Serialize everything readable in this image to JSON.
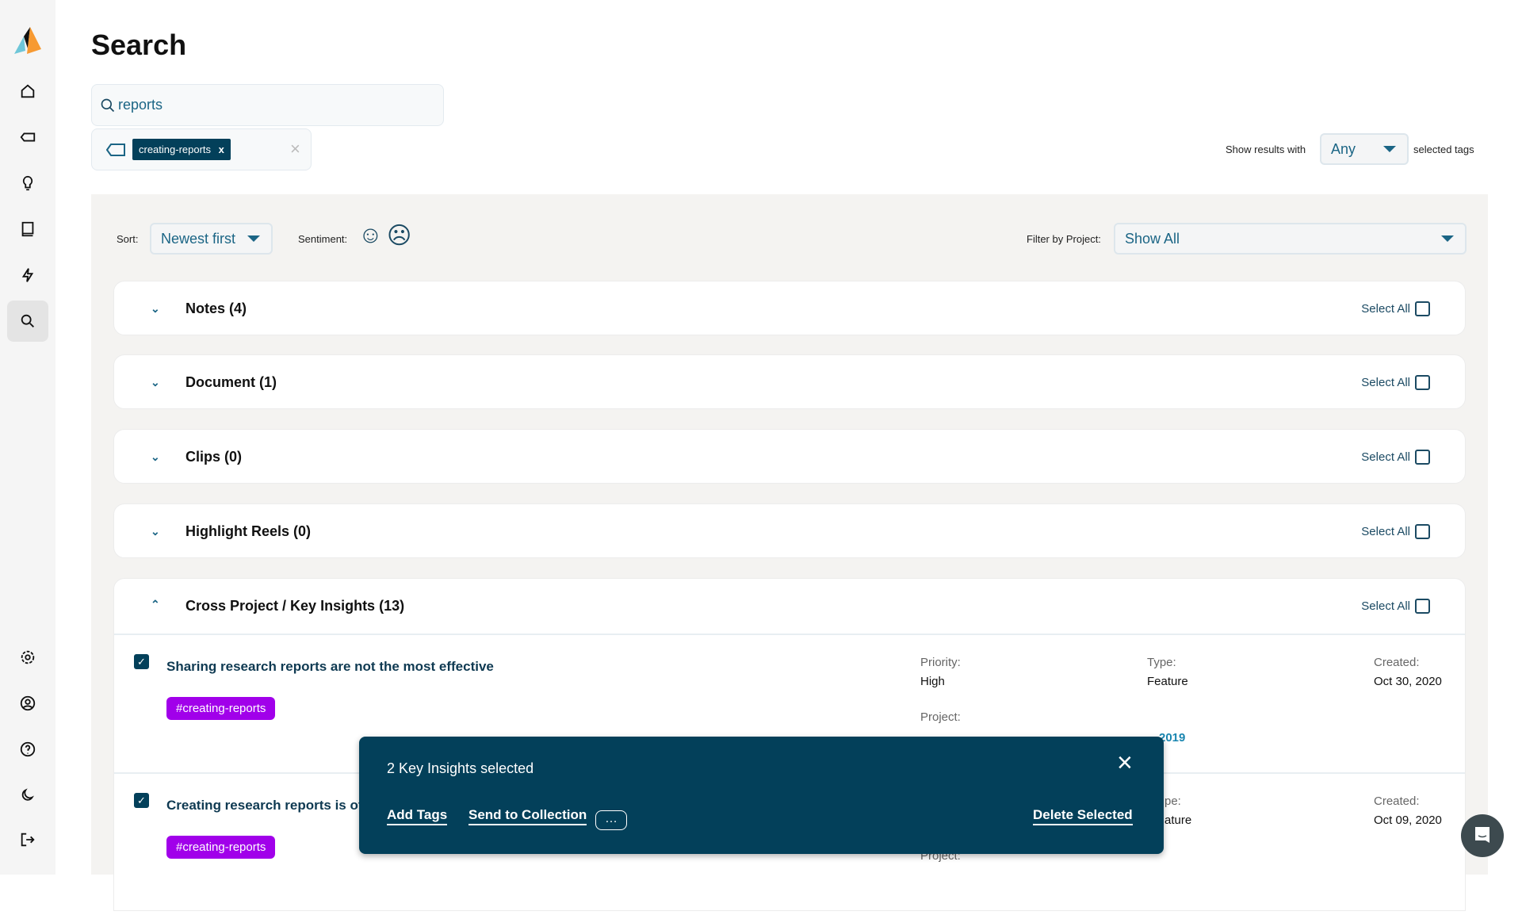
{
  "page": {
    "title": "Search"
  },
  "sidebar": {
    "items": [
      "home",
      "tags",
      "insights",
      "library",
      "activity",
      "search",
      "settings",
      "profile",
      "help",
      "dark-mode",
      "logout"
    ],
    "active": "search"
  },
  "search": {
    "value": "reports",
    "tags": [
      {
        "label": "creating-reports",
        "remove": "x"
      }
    ],
    "clear": "×"
  },
  "tag_match": {
    "prefix": "Show results with",
    "value": "Any",
    "suffix": "selected tags"
  },
  "toolbar": {
    "sort_label": "Sort:",
    "sort_value": "Newest first",
    "sentiment_label": "Sentiment:",
    "sentiment_positive": "☺",
    "sentiment_negative": "☹",
    "filter_label": "Filter by Project:",
    "filter_value": "Show All"
  },
  "sections": [
    {
      "title": "Notes (4)",
      "select_all": "Select All",
      "expanded": false
    },
    {
      "title": "Document (1)",
      "select_all": "Select All",
      "expanded": false
    },
    {
      "title": "Clips (0)",
      "select_all": "Select All",
      "expanded": false
    },
    {
      "title": "Highlight Reels (0)",
      "select_all": "Select All",
      "expanded": false
    },
    {
      "title": "Cross Project / Key Insights (13)",
      "select_all": "Select All",
      "expanded": true
    }
  ],
  "insights": [
    {
      "title": "Sharing research reports are not the most effective",
      "tag": "#creating-reports",
      "checked": true,
      "priority_label": "Priority:",
      "priority": "High",
      "type_label": "Type:",
      "type": "Feature",
      "created_label": "Created:",
      "created": "Oct 30, 2020",
      "project_label": "Project:",
      "project": "2019"
    },
    {
      "title": "Creating research reports is of",
      "tag": "#creating-reports",
      "checked": true,
      "type_label": "pe:",
      "type": "ature",
      "created_label": "Created:",
      "created": "Oct 09, 2020",
      "project_label": "Project:"
    }
  ],
  "selection_bar": {
    "count_text": "2 Key Insights selected",
    "add_tags": "Add Tags",
    "send_to_collection": "Send to Collection",
    "more": "…",
    "delete": "Delete Selected",
    "close": "×"
  },
  "colors": {
    "primary": "#03405a",
    "accent": "#1b6585",
    "tag": "#a100ea",
    "panel": "#f4f3f1"
  }
}
